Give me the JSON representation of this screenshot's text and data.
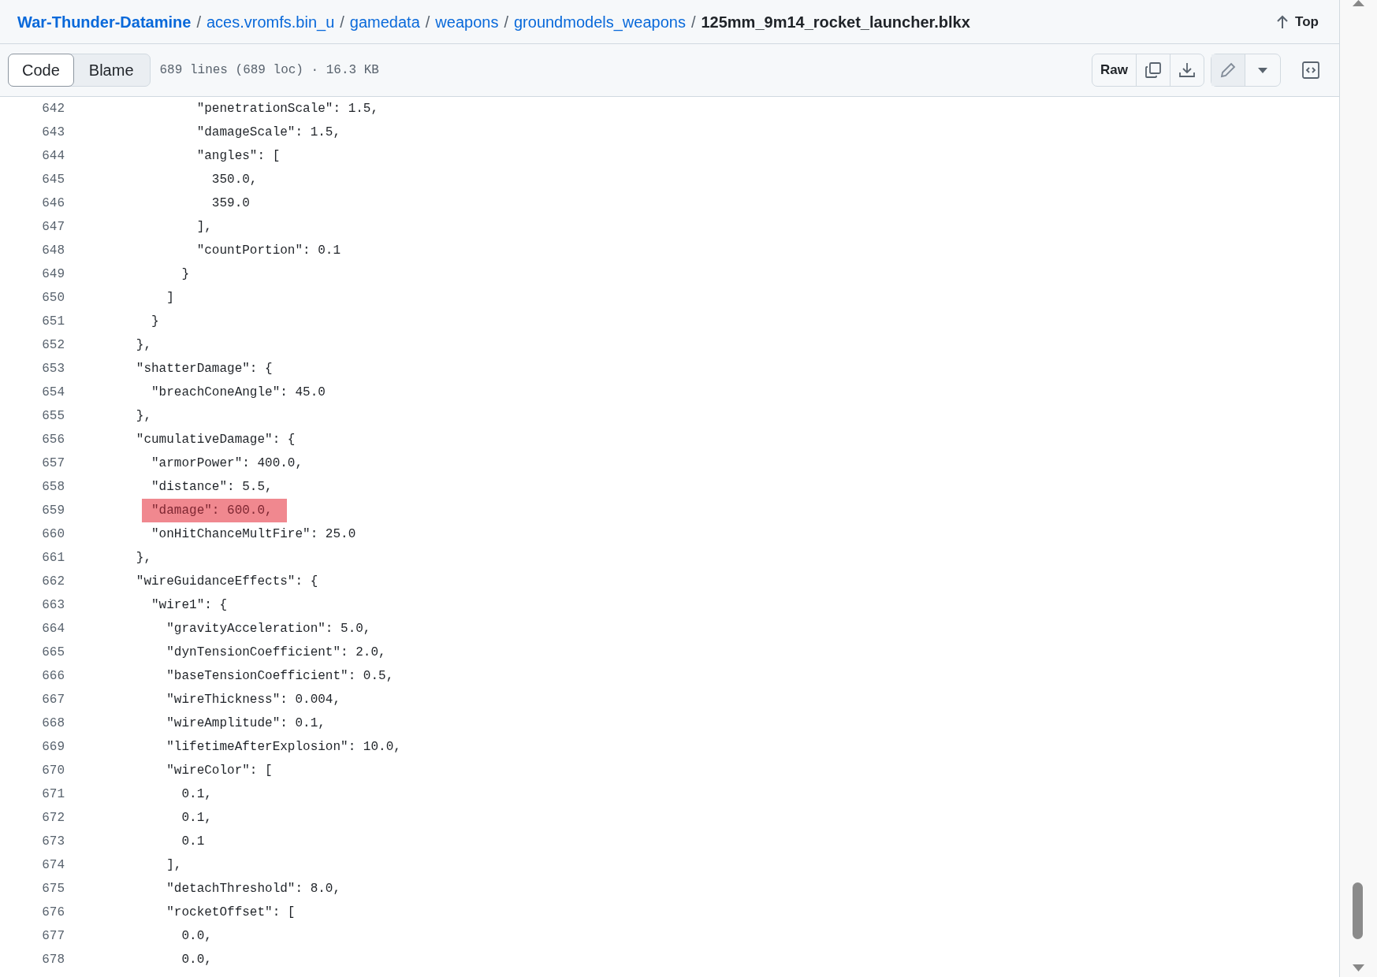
{
  "breadcrumb": [
    {
      "label": "War-Thunder-Datamine",
      "kind": "repo"
    },
    {
      "separator": "/",
      "label": "aces.vromfs.bin_u",
      "kind": "folder"
    },
    {
      "separator": "/",
      "label": "gamedata",
      "kind": "folder"
    },
    {
      "separator": "/",
      "label": "weapons",
      "kind": "folder"
    },
    {
      "separator": "/",
      "label": "groundmodels_weapons",
      "kind": "folder"
    },
    {
      "separator": "/",
      "label": "125mm_9m14_rocket_launcher.blkx",
      "kind": "current"
    }
  ],
  "top_link": "Top",
  "tabs": [
    {
      "label": "Code",
      "selected": true
    },
    {
      "label": "Blame",
      "selected": false
    }
  ],
  "file_info": "689 lines (689 loc) · 16.3 KB",
  "raw_button": "Raw",
  "lines": [
    {
      "number": "642",
      "text": "                \"penetrationScale\": 1.5,",
      "highlighted": false
    },
    {
      "number": "643",
      "text": "                \"damageScale\": 1.5,",
      "highlighted": false
    },
    {
      "number": "644",
      "text": "                \"angles\": [",
      "highlighted": false
    },
    {
      "number": "645",
      "text": "                  350.0,",
      "highlighted": false
    },
    {
      "number": "646",
      "text": "                  359.0",
      "highlighted": false
    },
    {
      "number": "647",
      "text": "                ],",
      "highlighted": false
    },
    {
      "number": "648",
      "text": "                \"countPortion\": 0.1",
      "highlighted": false
    },
    {
      "number": "649",
      "text": "              }",
      "highlighted": false
    },
    {
      "number": "650",
      "text": "            ]",
      "highlighted": false
    },
    {
      "number": "651",
      "text": "          }",
      "highlighted": false
    },
    {
      "number": "652",
      "text": "        },",
      "highlighted": false
    },
    {
      "number": "653",
      "text": "        \"shatterDamage\": {",
      "highlighted": false
    },
    {
      "number": "654",
      "text": "          \"breachConeAngle\": 45.0",
      "highlighted": false
    },
    {
      "number": "655",
      "text": "        },",
      "highlighted": false
    },
    {
      "number": "656",
      "text": "        \"cumulativeDamage\": {",
      "highlighted": false
    },
    {
      "number": "657",
      "text": "          \"armorPower\": 400.0,",
      "highlighted": false
    },
    {
      "number": "658",
      "text": "          \"distance\": 5.5,",
      "highlighted": false
    },
    {
      "number": "659",
      "text": "          \"damage\": 600.0,",
      "highlighted": true
    },
    {
      "number": "660",
      "text": "          \"onHitChanceMultFire\": 25.0",
      "highlighted": false
    },
    {
      "number": "661",
      "text": "        },",
      "highlighted": false
    },
    {
      "number": "662",
      "text": "        \"wireGuidanceEffects\": {",
      "highlighted": false
    },
    {
      "number": "663",
      "text": "          \"wire1\": {",
      "highlighted": false
    },
    {
      "number": "664",
      "text": "            \"gravityAcceleration\": 5.0,",
      "highlighted": false
    },
    {
      "number": "665",
      "text": "            \"dynTensionCoefficient\": 2.0,",
      "highlighted": false
    },
    {
      "number": "666",
      "text": "            \"baseTensionCoefficient\": 0.5,",
      "highlighted": false
    },
    {
      "number": "667",
      "text": "            \"wireThickness\": 0.004,",
      "highlighted": false
    },
    {
      "number": "668",
      "text": "            \"wireAmplitude\": 0.1,",
      "highlighted": false
    },
    {
      "number": "669",
      "text": "            \"lifetimeAfterExplosion\": 10.0,",
      "highlighted": false
    },
    {
      "number": "670",
      "text": "            \"wireColor\": [",
      "highlighted": false
    },
    {
      "number": "671",
      "text": "              0.1,",
      "highlighted": false
    },
    {
      "number": "672",
      "text": "              0.1,",
      "highlighted": false
    },
    {
      "number": "673",
      "text": "              0.1",
      "highlighted": false
    },
    {
      "number": "674",
      "text": "            ],",
      "highlighted": false
    },
    {
      "number": "675",
      "text": "            \"detachThreshold\": 8.0,",
      "highlighted": false
    },
    {
      "number": "676",
      "text": "            \"rocketOffset\": [",
      "highlighted": false
    },
    {
      "number": "677",
      "text": "              0.0,",
      "highlighted": false
    },
    {
      "number": "678",
      "text": "              0.0,",
      "highlighted": false
    }
  ]
}
